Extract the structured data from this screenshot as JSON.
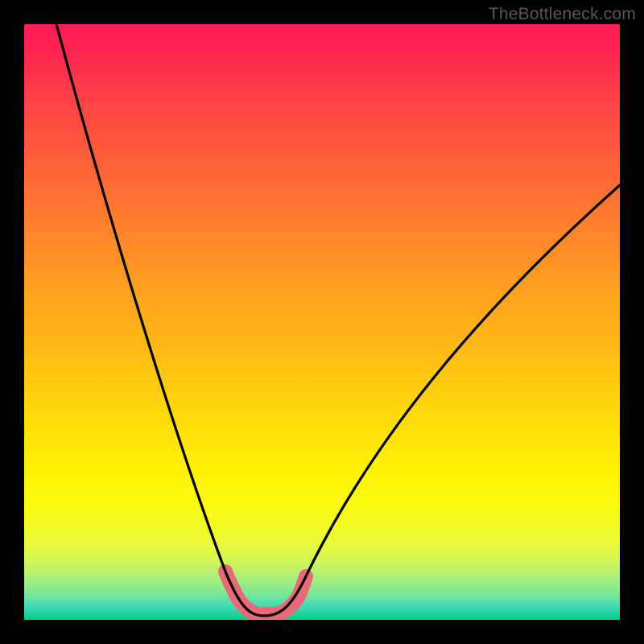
{
  "watermark": "TheBottleneck.com",
  "chart_data": {
    "type": "line",
    "title": "",
    "xlabel": "",
    "ylabel": "",
    "xlim": [
      0,
      100
    ],
    "ylim": [
      0,
      100
    ],
    "series": [
      {
        "name": "bottleneck-curve",
        "x": [
          4,
          10,
          16,
          22,
          28,
          32,
          36,
          38,
          40,
          42,
          44,
          48,
          54,
          62,
          72,
          84,
          100
        ],
        "y": [
          100,
          82,
          64,
          47,
          30,
          18,
          9,
          5,
          3,
          3,
          5,
          9,
          18,
          30,
          44,
          58,
          73
        ]
      }
    ],
    "annotations": [
      {
        "name": "highlight-valley",
        "type": "band",
        "x_range": [
          34,
          46
        ],
        "color": "#e86a76"
      }
    ],
    "background_gradient": {
      "top": "#ff1a53",
      "mid": "#fff205",
      "bottom": "#00d084"
    }
  }
}
